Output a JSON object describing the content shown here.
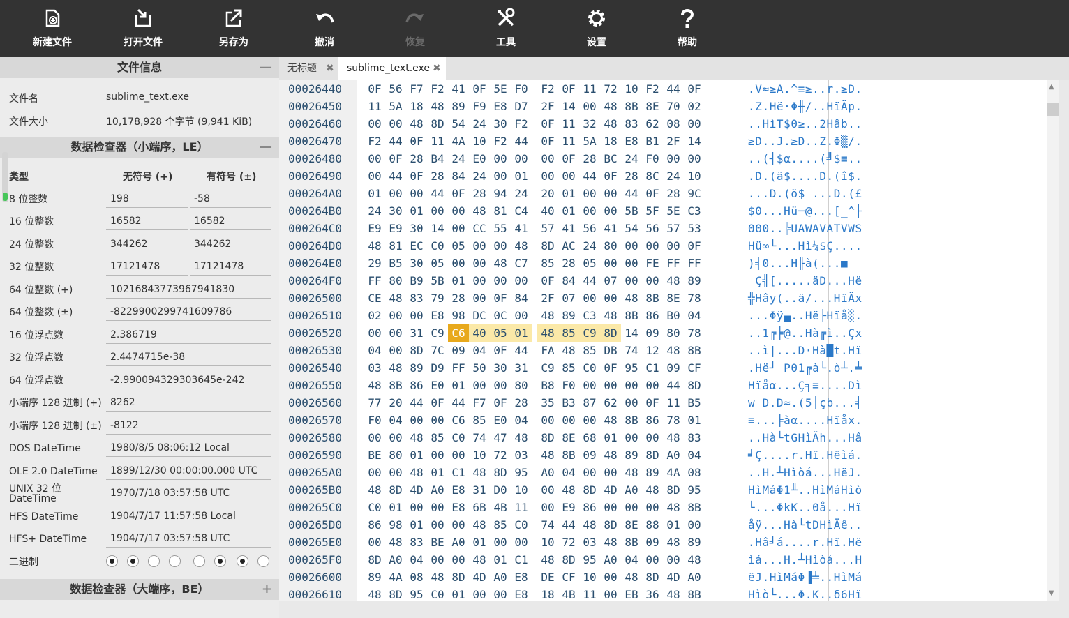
{
  "toolbar": {
    "new_file": "新建文件",
    "open_file": "打开文件",
    "save_as": "另存为",
    "undo": "撤消",
    "redo": "恢复",
    "tools": "工具",
    "settings": "设置",
    "help": "帮助"
  },
  "file_info": {
    "header": "文件信息",
    "name_label": "文件名",
    "name_value": "sublime_text.exe",
    "size_label": "文件大小",
    "size_value": "10,178,928 个字节 (9,941 KiB)"
  },
  "inspector": {
    "header": "数据检查器（小端序，LE）",
    "col_type": "类型",
    "col_unsigned": "无符号 (+)",
    "col_signed": "有符号 (±)",
    "int8_label": "8 位整数",
    "int8_u": "198",
    "int8_s": "-58",
    "int16_label": "16 位整数",
    "int16_u": "16582",
    "int16_s": "16582",
    "int24_label": "24 位整数",
    "int24_u": "344262",
    "int24_s": "344262",
    "int32_label": "32 位整数",
    "int32_u": "17121478",
    "int32_s": "17121478",
    "int64u_label": "64 位整数 (+)",
    "int64u_v": "10216843773967941830",
    "int64s_label": "64 位整数 (±)",
    "int64s_v": "-8229900299741609786",
    "f16_label": "16 位浮点数",
    "f16_v": "2.386719",
    "f32_label": "32 位浮点数",
    "f32_v": "2.4474715e-38",
    "f64_label": "64 位浮点数",
    "f64_v": "-2.990094329303645e-242",
    "le128u_label": "小端序 128 进制 (+)",
    "le128u_v": "8262",
    "le128s_label": "小端序 128 进制 (±)",
    "le128s_v": "-8122",
    "dos_label": "DOS DateTime",
    "dos_v": "1980/8/5 08:06:12 Local",
    "ole_label": "OLE 2.0 DateTime",
    "ole_v": "1899/12/30 00:00:00.000 UTC",
    "unix_label1": "UNIX 32 位",
    "unix_label2": "DateTime",
    "unix_v": "1970/7/18 03:57:58 UTC",
    "hfs_label": "HFS DateTime",
    "hfs_v": "1904/7/17 11:57:58 Local",
    "hfsp_label": "HFS+ DateTime",
    "hfsp_v": "1904/7/17 03:57:58 UTC",
    "binary_label": "二进制",
    "binary_bits": [
      1,
      1,
      0,
      0,
      0,
      1,
      1,
      0
    ]
  },
  "inspector_be": {
    "header": "数据检查器（大端序，BE）"
  },
  "tabs": [
    {
      "label": "无标题"
    },
    {
      "label": "sublime_text.exe"
    }
  ],
  "hex": {
    "rows": [
      {
        "addr": "00026440",
        "bytes": [
          "0F",
          "56",
          "F7",
          "F2",
          "41",
          "0F",
          "5E",
          "F0",
          "F2",
          "0F",
          "11",
          "72",
          "10",
          "F2",
          "44",
          "0F"
        ],
        "ascii": ".V≈≥A.^≡≥..r.≥D."
      },
      {
        "addr": "00026450",
        "bytes": [
          "11",
          "5A",
          "18",
          "48",
          "89",
          "F9",
          "E8",
          "D7",
          "2F",
          "14",
          "00",
          "48",
          "8B",
          "8E",
          "70",
          "02"
        ],
        "ascii": ".Z.Hë·Φ╫/..HïÄp."
      },
      {
        "addr": "00026460",
        "bytes": [
          "00",
          "00",
          "48",
          "8D",
          "54",
          "24",
          "30",
          "F2",
          "0F",
          "11",
          "32",
          "48",
          "83",
          "62",
          "08",
          "00"
        ],
        "ascii": "..HìT$0≥..2Hâb.."
      },
      {
        "addr": "00026470",
        "bytes": [
          "F2",
          "44",
          "0F",
          "11",
          "4A",
          "10",
          "F2",
          "44",
          "0F",
          "11",
          "5A",
          "18",
          "E8",
          "B1",
          "2F",
          "14"
        ],
        "ascii": "≥D..J.≥D..Z.Φ▒/."
      },
      {
        "addr": "00026480",
        "bytes": [
          "00",
          "0F",
          "28",
          "B4",
          "24",
          "E0",
          "00",
          "00",
          "00",
          "0F",
          "28",
          "BC",
          "24",
          "F0",
          "00",
          "00"
        ],
        "ascii": "..(┤$α....(╝$≡.."
      },
      {
        "addr": "00026490",
        "bytes": [
          "00",
          "44",
          "0F",
          "28",
          "84",
          "24",
          "00",
          "01",
          "00",
          "00",
          "44",
          "0F",
          "28",
          "8C",
          "24",
          "10"
        ],
        "ascii": ".D.(ä$....D.(î$."
      },
      {
        "addr": "000264A0",
        "bytes": [
          "01",
          "00",
          "00",
          "44",
          "0F",
          "28",
          "94",
          "24",
          "20",
          "01",
          "00",
          "00",
          "44",
          "0F",
          "28",
          "9C"
        ],
        "ascii": "...D.(ö$ ...D.(£"
      },
      {
        "addr": "000264B0",
        "bytes": [
          "24",
          "30",
          "01",
          "00",
          "00",
          "48",
          "81",
          "C4",
          "40",
          "01",
          "00",
          "00",
          "5B",
          "5F",
          "5E",
          "C3"
        ],
        "ascii": "$0...Hü─@...[_^├"
      },
      {
        "addr": "000264C0",
        "bytes": [
          "E9",
          "E9",
          "30",
          "14",
          "00",
          "CC",
          "55",
          "41",
          "57",
          "41",
          "56",
          "41",
          "54",
          "56",
          "57",
          "53"
        ],
        "ascii": "ΘΘ0..╠UAWAVATVWS"
      },
      {
        "addr": "000264D0",
        "bytes": [
          "48",
          "81",
          "EC",
          "C0",
          "05",
          "00",
          "00",
          "48",
          "8D",
          "AC",
          "24",
          "80",
          "00",
          "00",
          "00",
          "0F"
        ],
        "ascii": "Hü∞└...Hì¼$Ç...."
      },
      {
        "addr": "000264E0",
        "bytes": [
          "29",
          "B5",
          "30",
          "05",
          "00",
          "00",
          "48",
          "C7",
          "85",
          "28",
          "05",
          "00",
          "00",
          "FE",
          "FF",
          "FF"
        ],
        "ascii": ")╡0...H╟à(...■  "
      },
      {
        "addr": "000264F0",
        "bytes": [
          "FF",
          "80",
          "B9",
          "5B",
          "01",
          "00",
          "00",
          "00",
          "0F",
          "84",
          "44",
          "07",
          "00",
          "00",
          "48",
          "89"
        ],
        "ascii": " Ç╣[.....äD...Hë"
      },
      {
        "addr": "00026500",
        "bytes": [
          "CE",
          "48",
          "83",
          "79",
          "28",
          "00",
          "0F",
          "84",
          "2F",
          "07",
          "00",
          "00",
          "48",
          "8B",
          "8E",
          "78"
        ],
        "ascii": "╬Hây(..ä/...HïÄx"
      },
      {
        "addr": "00026510",
        "bytes": [
          "02",
          "00",
          "00",
          "E8",
          "98",
          "DC",
          "0C",
          "00",
          "48",
          "89",
          "C3",
          "48",
          "8B",
          "86",
          "B0",
          "04"
        ],
        "ascii": "...Φÿ▄..Hë├Hïå░."
      },
      {
        "addr": "00026520",
        "bytes": [
          "00",
          "00",
          "31",
          "C9",
          "C6",
          "40",
          "05",
          "01",
          "48",
          "85",
          "C9",
          "8D",
          "14",
          "09",
          "80",
          "78"
        ],
        "ascii": "..1╔╞@..Hà╔ì..Çx"
      },
      {
        "addr": "00026530",
        "bytes": [
          "04",
          "00",
          "8D",
          "7C",
          "09",
          "04",
          "0F",
          "44",
          "FA",
          "48",
          "85",
          "DB",
          "74",
          "12",
          "48",
          "8B"
        ],
        "ascii": "..ì|...D·Hà█t.Hï"
      },
      {
        "addr": "00026540",
        "bytes": [
          "03",
          "48",
          "89",
          "D9",
          "FF",
          "50",
          "30",
          "31",
          "C9",
          "85",
          "C0",
          "0F",
          "95",
          "C1",
          "09",
          "CF"
        ],
        "ascii": ".Hë┘ P01╔à└.ò┴.╧"
      },
      {
        "addr": "00026550",
        "bytes": [
          "48",
          "8B",
          "86",
          "E0",
          "01",
          "00",
          "00",
          "80",
          "B8",
          "F0",
          "00",
          "00",
          "00",
          "00",
          "44",
          "8D"
        ],
        "ascii": "Hïåα...Ç╕≡....Dì"
      },
      {
        "addr": "00026560",
        "bytes": [
          "77",
          "20",
          "44",
          "0F",
          "44",
          "F7",
          "0F",
          "28",
          "35",
          "B3",
          "87",
          "62",
          "00",
          "0F",
          "11",
          "B5"
        ],
        "ascii": "w D.D≈.(5│çb...╡"
      },
      {
        "addr": "00026570",
        "bytes": [
          "F0",
          "04",
          "00",
          "00",
          "C6",
          "85",
          "E0",
          "04",
          "00",
          "00",
          "00",
          "48",
          "8B",
          "86",
          "78",
          "01"
        ],
        "ascii": "≡...╞àα....Hïåx."
      },
      {
        "addr": "00026580",
        "bytes": [
          "00",
          "00",
          "48",
          "85",
          "C0",
          "74",
          "47",
          "48",
          "8D",
          "8E",
          "68",
          "01",
          "00",
          "00",
          "48",
          "83"
        ],
        "ascii": "..Hà└tGHìÄh...Hâ"
      },
      {
        "addr": "00026590",
        "bytes": [
          "BE",
          "80",
          "01",
          "00",
          "00",
          "10",
          "72",
          "03",
          "48",
          "8B",
          "09",
          "48",
          "89",
          "8D",
          "A0",
          "04"
        ],
        "ascii": "╛Ç....r.Hï.Hëìá."
      },
      {
        "addr": "000265A0",
        "bytes": [
          "00",
          "00",
          "48",
          "01",
          "C1",
          "48",
          "8D",
          "95",
          "A0",
          "04",
          "00",
          "00",
          "48",
          "89",
          "4A",
          "08"
        ],
        "ascii": "..H.┴Hìòá...HëJ."
      },
      {
        "addr": "000265B0",
        "bytes": [
          "48",
          "8D",
          "4D",
          "A0",
          "E8",
          "31",
          "D0",
          "10",
          "00",
          "48",
          "8D",
          "4D",
          "A0",
          "48",
          "8D",
          "95"
        ],
        "ascii": "HìMáΦ1╨..HìMáHìò"
      },
      {
        "addr": "000265C0",
        "bytes": [
          "C0",
          "01",
          "00",
          "00",
          "E8",
          "6B",
          "4B",
          "11",
          "00",
          "E9",
          "86",
          "00",
          "00",
          "00",
          "48",
          "8B"
        ],
        "ascii": "└...ΦkK..Θå...Hï"
      },
      {
        "addr": "000265D0",
        "bytes": [
          "86",
          "98",
          "01",
          "00",
          "00",
          "48",
          "85",
          "C0",
          "74",
          "44",
          "48",
          "8D",
          "8E",
          "88",
          "01",
          "00"
        ],
        "ascii": "åÿ...Hà└tDHìÄê.."
      },
      {
        "addr": "000265E0",
        "bytes": [
          "00",
          "48",
          "83",
          "BE",
          "A0",
          "01",
          "00",
          "00",
          "10",
          "72",
          "03",
          "48",
          "8B",
          "09",
          "48",
          "89"
        ],
        "ascii": ".Hâ╛á....r.Hï.Hë"
      },
      {
        "addr": "000265F0",
        "bytes": [
          "8D",
          "A0",
          "04",
          "00",
          "00",
          "48",
          "01",
          "C1",
          "48",
          "8D",
          "95",
          "A0",
          "04",
          "00",
          "00",
          "48"
        ],
        "ascii": "ìá...H.┴Hìòá...H"
      },
      {
        "addr": "00026600",
        "bytes": [
          "89",
          "4A",
          "08",
          "48",
          "8D",
          "4D",
          "A0",
          "E8",
          "DE",
          "CF",
          "10",
          "00",
          "48",
          "8D",
          "4D",
          "A0"
        ],
        "ascii": "ëJ.HìMáΦ▐╧..HìMá"
      },
      {
        "addr": "00026610",
        "bytes": [
          "48",
          "8D",
          "95",
          "C0",
          "01",
          "00",
          "00",
          "E8",
          "18",
          "4B",
          "11",
          "00",
          "EB",
          "36",
          "48",
          "8B"
        ],
        "ascii": "Hìò└...Φ.K..δ6Hï"
      }
    ]
  }
}
